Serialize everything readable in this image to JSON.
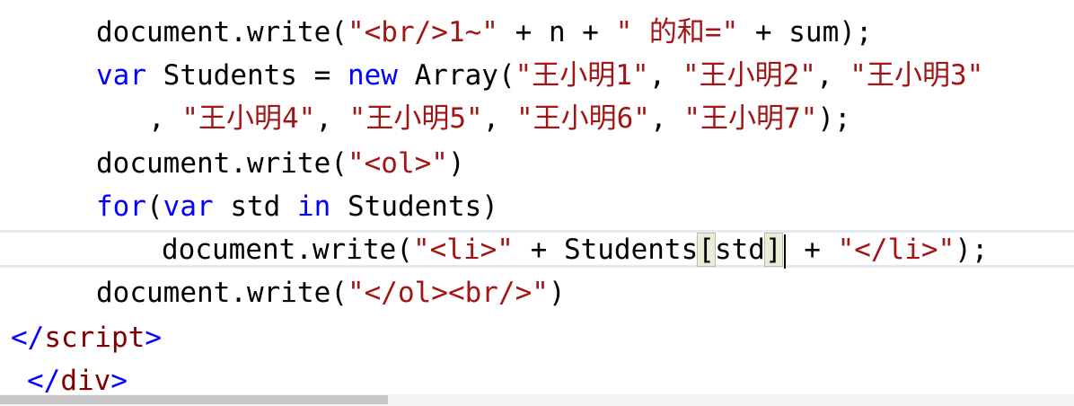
{
  "editor": {
    "colors": {
      "plain": "#000000",
      "keyword": "#0000ff",
      "string": "#a31515",
      "tag": "#800000",
      "current_line_border": "#e6e8ef",
      "bracket_match": "#e8ecd8"
    },
    "lines": [
      {
        "tokens": [
          {
            "text": "document.write(",
            "type": "plain"
          },
          {
            "text": "\"<br/>1~\"",
            "type": "string"
          },
          {
            "text": " + n + ",
            "type": "plain"
          },
          {
            "text": "\" 的和=\"",
            "type": "string"
          },
          {
            "text": " + sum);",
            "type": "plain"
          }
        ]
      },
      {
        "tokens": [
          {
            "text": "var",
            "type": "keyword"
          },
          {
            "text": " Students = ",
            "type": "plain"
          },
          {
            "text": "new",
            "type": "keyword"
          },
          {
            "text": " Array(",
            "type": "plain"
          },
          {
            "text": "\"王小明1\"",
            "type": "string"
          },
          {
            "text": ", ",
            "type": "plain"
          },
          {
            "text": "\"王小明2\"",
            "type": "string"
          },
          {
            "text": ", ",
            "type": "plain"
          },
          {
            "text": "\"王小明3\"",
            "type": "string"
          }
        ]
      },
      {
        "tokens": [
          {
            "text": ", ",
            "type": "plain"
          },
          {
            "text": "\"王小明4\"",
            "type": "string"
          },
          {
            "text": ", ",
            "type": "plain"
          },
          {
            "text": "\"王小明5\"",
            "type": "string"
          },
          {
            "text": ", ",
            "type": "plain"
          },
          {
            "text": "\"王小明6\"",
            "type": "string"
          },
          {
            "text": ", ",
            "type": "plain"
          },
          {
            "text": "\"王小明7\"",
            "type": "string"
          },
          {
            "text": ");",
            "type": "plain"
          }
        ]
      },
      {
        "tokens": [
          {
            "text": "document.write(",
            "type": "plain"
          },
          {
            "text": "\"<ol>\"",
            "type": "string"
          },
          {
            "text": ")",
            "type": "plain"
          }
        ]
      },
      {
        "tokens": [
          {
            "text": "for",
            "type": "keyword"
          },
          {
            "text": "(",
            "type": "plain"
          },
          {
            "text": "var",
            "type": "keyword"
          },
          {
            "text": " std ",
            "type": "plain"
          },
          {
            "text": "in",
            "type": "keyword"
          },
          {
            "text": " Students)",
            "type": "plain"
          }
        ]
      },
      {
        "tokens": [
          {
            "text": "document.write(",
            "type": "plain"
          },
          {
            "text": "\"<li>\"",
            "type": "string"
          },
          {
            "text": " + Students",
            "type": "plain"
          },
          {
            "text": "[",
            "type": "plain"
          },
          {
            "text": "std",
            "type": "plain"
          },
          {
            "text": "]",
            "type": "plain"
          },
          {
            "text": " + ",
            "type": "plain"
          },
          {
            "text": "\"</li>\"",
            "type": "string"
          },
          {
            "text": ");",
            "type": "plain"
          }
        ]
      },
      {
        "tokens": [
          {
            "text": "document.write(",
            "type": "plain"
          },
          {
            "text": "\"</ol><br/>\"",
            "type": "string"
          },
          {
            "text": ")",
            "type": "plain"
          }
        ]
      },
      {
        "tokens": [
          {
            "text": "</",
            "type": "bracket"
          },
          {
            "text": "script",
            "type": "tag"
          },
          {
            "text": ">",
            "type": "bracket"
          }
        ]
      },
      {
        "tokens": [
          {
            "text": "</",
            "type": "bracket"
          },
          {
            "text": "div",
            "type": "tag"
          },
          {
            "text": ">",
            "type": "bracket"
          }
        ]
      }
    ]
  }
}
